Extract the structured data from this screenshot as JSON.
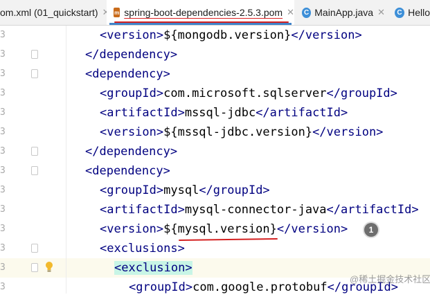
{
  "tabs": [
    {
      "label": "om.xml (01_quickstart)",
      "icon": "maven-pom-icon",
      "active": false
    },
    {
      "label": "spring-boot-dependencies-2.5.3.pom",
      "icon": "maven-pom-icon",
      "active": true
    },
    {
      "label": "MainApp.java",
      "icon": "java-class-icon",
      "active": false
    },
    {
      "label": "Hello",
      "icon": "java-class-icon",
      "active": false
    }
  ],
  "tab_close_glyph": "✕",
  "code": {
    "lines": [
      {
        "indent": 2,
        "open": "version",
        "text": "${mongodb.version}",
        "close": "version"
      },
      {
        "indent": 1,
        "close_only": "dependency"
      },
      {
        "indent": 1,
        "open_only": "dependency"
      },
      {
        "indent": 2,
        "open": "groupId",
        "text": "com.microsoft.sqlserver",
        "close": "groupId"
      },
      {
        "indent": 2,
        "open": "artifactId",
        "text": "mssql-jdbc",
        "close": "artifactId"
      },
      {
        "indent": 2,
        "open": "version",
        "text": "${mssql-jdbc.version}",
        "close": "version"
      },
      {
        "indent": 1,
        "close_only": "dependency"
      },
      {
        "indent": 1,
        "open_only": "dependency"
      },
      {
        "indent": 2,
        "open": "groupId",
        "text": "mysql",
        "close": "groupId"
      },
      {
        "indent": 2,
        "open": "artifactId",
        "text": "mysql-connector-java",
        "close": "artifactId"
      },
      {
        "indent": 2,
        "open": "version",
        "text": "${mysql.version}",
        "close": "version"
      },
      {
        "indent": 2,
        "open_only": "exclusions"
      },
      {
        "indent": 3,
        "open_only": "exclusion"
      },
      {
        "indent": 4,
        "open": "groupId",
        "text": "com.google.protobuf",
        "close": "groupId"
      }
    ]
  },
  "annotation": {
    "badge_number": "1"
  },
  "watermark": "@稀土掘金技术社区",
  "colors": {
    "tag": "#000080",
    "annotation_red": "#d42020",
    "active_tab_underline": "#4083c9",
    "tag_highlight": "#c8f5e6"
  }
}
